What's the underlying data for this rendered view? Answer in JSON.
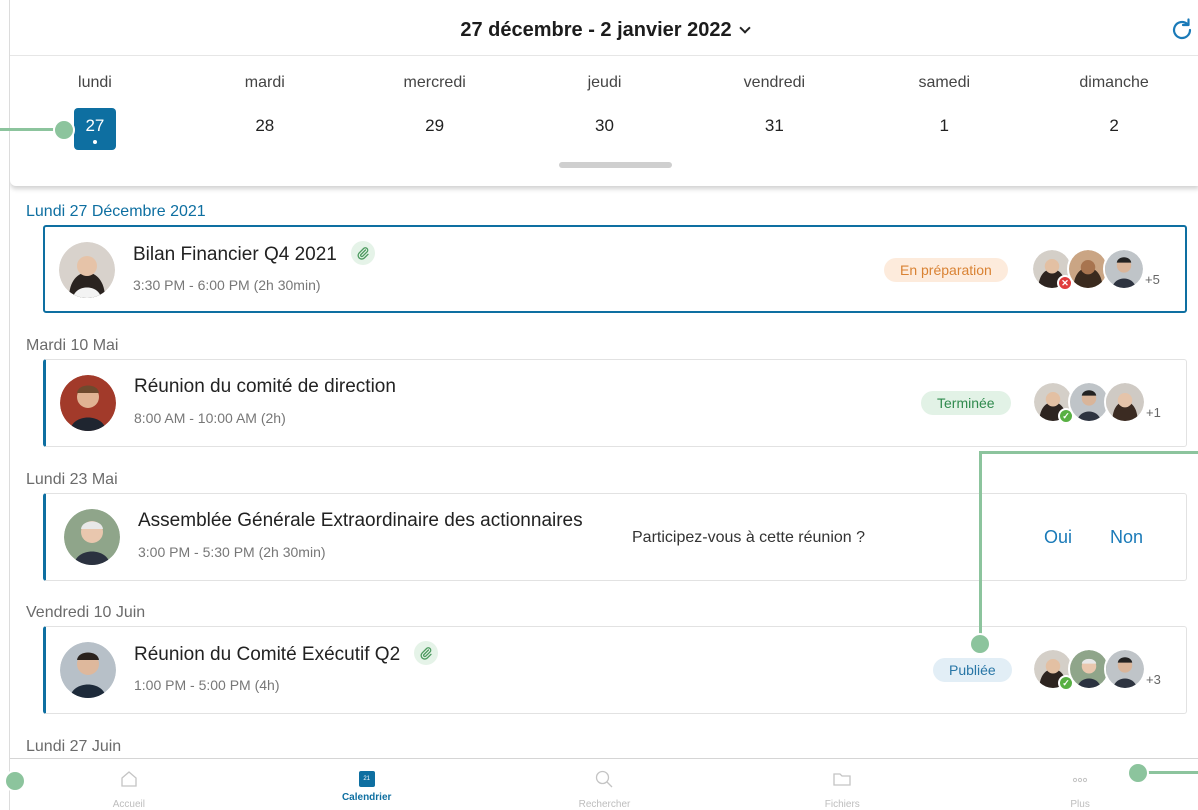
{
  "colors": {
    "accent": "#0e6fa1",
    "preparation": "#d98233",
    "done": "#2f8a4d",
    "published": "#2876a6",
    "annotation": "#8cc49d"
  },
  "header": {
    "week_range": "27 décembre - 2 janvier 2022",
    "refresh_icon": "refresh-icon",
    "days": [
      {
        "name": "lundi",
        "num": "27",
        "selected": true
      },
      {
        "name": "mardi",
        "num": "28"
      },
      {
        "name": "mercredi",
        "num": "29"
      },
      {
        "name": "jeudi",
        "num": "30"
      },
      {
        "name": "vendredi",
        "num": "31"
      },
      {
        "name": "samedi",
        "num": "1"
      },
      {
        "name": "dimanche",
        "num": "2"
      }
    ]
  },
  "events": [
    {
      "date_label": "Lundi 27 Décembre 2021",
      "title": "Bilan Financier Q4 2021",
      "time": "3:30 PM - 6:00 PM (2h 30min)",
      "attachment": true,
      "status": "En préparation",
      "participants_more": "+5"
    },
    {
      "date_label": "Mardi 10 Mai",
      "title": "Réunion du comité de direction",
      "time": "8:00 AM - 10:00 AM (2h)",
      "status": "Terminée",
      "participants_more": "+1"
    },
    {
      "date_label": "Lundi 23 Mai",
      "title": "Assemblée Générale Extraordinaire des actionnaires",
      "time": "3:00 PM - 5:30 PM (2h 30min)",
      "question": "Participez-vous à cette réunion ?",
      "yes_label": "Oui",
      "no_label": "Non"
    },
    {
      "date_label": "Vendredi 10 Juin",
      "title": "Réunion du Comité Exécutif Q2",
      "time": "1:00 PM - 5:00 PM (4h)",
      "attachment": true,
      "status": "Publiée",
      "participants_more": "+3"
    },
    {
      "date_label": "Lundi 27 Juin"
    }
  ],
  "tabbar": [
    {
      "label": "Accueil",
      "icon": "home-icon"
    },
    {
      "label": "Calendrier",
      "icon": "calendar-icon",
      "active": true,
      "icon_text": "21"
    },
    {
      "label": "Rechercher",
      "icon": "search-icon"
    },
    {
      "label": "Fichiers",
      "icon": "folder-icon"
    },
    {
      "label": "Plus",
      "icon": "more-icon"
    }
  ]
}
